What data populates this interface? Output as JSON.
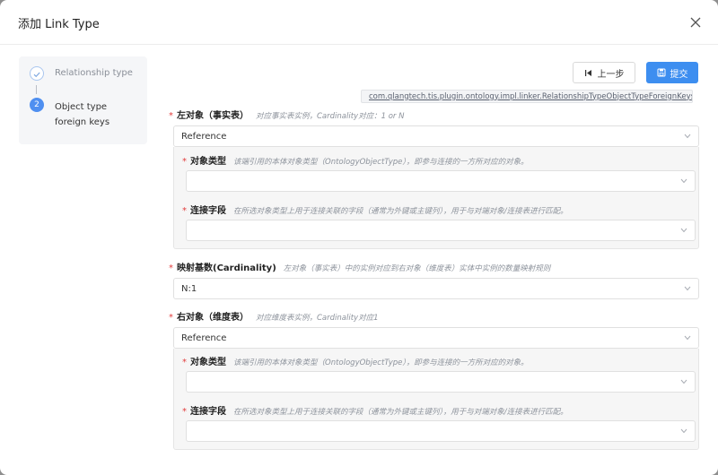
{
  "dialog": {
    "title": "添加 Link Type"
  },
  "steps": [
    {
      "label": "Relationship type",
      "state": "done"
    },
    {
      "number": "2",
      "label": "Object type foreign keys",
      "state": "active"
    }
  ],
  "toolbar": {
    "prev_label": "上一步",
    "submit_label": "提交"
  },
  "classpath": "com.qlangtech.tis.plugin.ontology.impl.linker.RelationshipTypeObjectTypeForeignKeys",
  "form": {
    "left": {
      "label": "左对象（事实表）",
      "hint": "对应事实表实例，Cardinality对应：1 or N",
      "value": "Reference",
      "object_type": {
        "label": "对象类型",
        "hint": "该端引用的本体对象类型（OntologyObjectType），即参与连接的一方所对应的对象。",
        "value": ""
      },
      "join_field": {
        "label": "连接字段",
        "hint": "在所选对象类型上用于连接关联的字段（通常为外键或主键列），用于与对端对象/连接表进行匹配。",
        "value": ""
      }
    },
    "cardinality": {
      "label": "映射基数(Cardinality)",
      "hint": "左对象（事实表）中的实例对应到右对象（维度表）实体中实例的数量映射规则",
      "value": "N:1"
    },
    "right": {
      "label": "右对象（维度表）",
      "hint": "对应维度表实例，Cardinality对应1",
      "value": "Reference",
      "object_type": {
        "label": "对象类型",
        "hint": "该端引用的本体对象类型（OntologyObjectType），即参与连接的一方所对应的对象。",
        "value": ""
      },
      "join_field": {
        "label": "连接字段",
        "hint": "在所选对象类型上用于连接关联的字段（通常为外键或主键列），用于与对端对象/连接表进行匹配。",
        "value": ""
      }
    }
  },
  "colors": {
    "primary": "#3d8ef0",
    "required": "#e23d3d",
    "step_active": "#4f8ff0"
  }
}
